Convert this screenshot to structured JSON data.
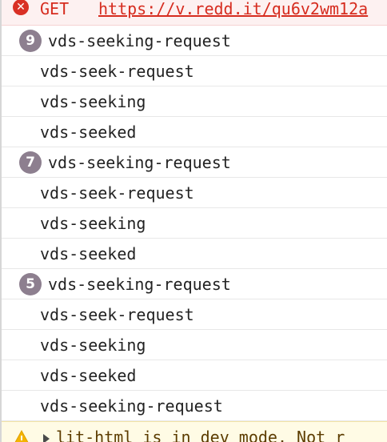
{
  "error_row": {
    "icon": "error-circle-x-icon",
    "icon_glyph": "✕",
    "method": "GET",
    "url": "https://v.redd.it/qu6v2wm12a"
  },
  "log_rows": [
    {
      "count": "9",
      "text": "vds-seeking-request"
    },
    {
      "count": null,
      "text": "vds-seek-request"
    },
    {
      "count": null,
      "text": "vds-seeking"
    },
    {
      "count": null,
      "text": "vds-seeked"
    },
    {
      "count": "7",
      "text": "vds-seeking-request"
    },
    {
      "count": null,
      "text": "vds-seek-request"
    },
    {
      "count": null,
      "text": "vds-seeking"
    },
    {
      "count": null,
      "text": "vds-seeked"
    },
    {
      "count": "5",
      "text": "vds-seeking-request"
    },
    {
      "count": null,
      "text": "vds-seek-request"
    },
    {
      "count": null,
      "text": "vds-seeking"
    },
    {
      "count": null,
      "text": "vds-seeked"
    },
    {
      "count": null,
      "text": "vds-seeking-request"
    }
  ],
  "warning_row": {
    "icon": "warning-triangle-icon",
    "text": "lit-html is in dev mode. Not r"
  },
  "colors": {
    "error_text": "#d62c1f",
    "error_bg": "#fdf1f1",
    "badge_bg": "#8d7f8f",
    "warning_bg": "#fffbe5",
    "row_border": "#e8e8e8"
  }
}
